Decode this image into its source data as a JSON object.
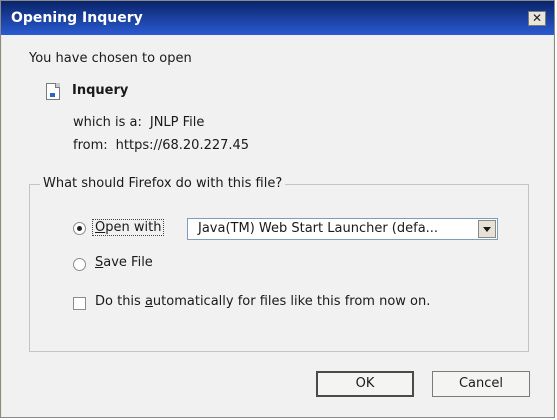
{
  "window": {
    "title": "Opening Inquery",
    "close_glyph": "✕"
  },
  "intro_text": "You have chosen to open",
  "file": {
    "name": "Inquery",
    "type_label": "which is a:",
    "type_value": "JNLP File",
    "from_label": "from:",
    "from_value": "https://68.20.227.45"
  },
  "action_group": {
    "legend": "What should Firefox do with this file?",
    "open_with_label": "Open with",
    "open_with_selected": true,
    "application_value": "Java(TM) Web Start Launcher (defa...",
    "save_file_label": "Save File",
    "save_file_selected": false,
    "auto_label": "Do this automatically for files like this from now on.",
    "auto_checked": false
  },
  "buttons": {
    "ok": "OK",
    "cancel": "Cancel"
  },
  "icons": {
    "file": "file-icon",
    "close": "close-icon",
    "dropdown": "chevron-down-icon"
  }
}
